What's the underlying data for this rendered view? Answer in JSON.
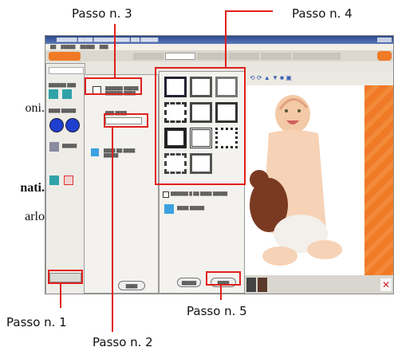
{
  "annotations": {
    "step1": "Passo n. 1",
    "step2": "Passo n. 2",
    "step3": "Passo n. 3",
    "step4": "Passo n. 4",
    "step5": "Passo n. 5"
  },
  "side_text": {
    "line1": "oni.",
    "line2": "nati.",
    "line3": "arlo"
  },
  "colors": {
    "annotation_red": "#e0201c",
    "app_orange": "#f07a26",
    "title_blue": "#2b4a8a"
  },
  "icons": [
    "app-icon",
    "window-controls-icon",
    "shape-circle-icon",
    "frame-tile-icon",
    "close-icon"
  ]
}
